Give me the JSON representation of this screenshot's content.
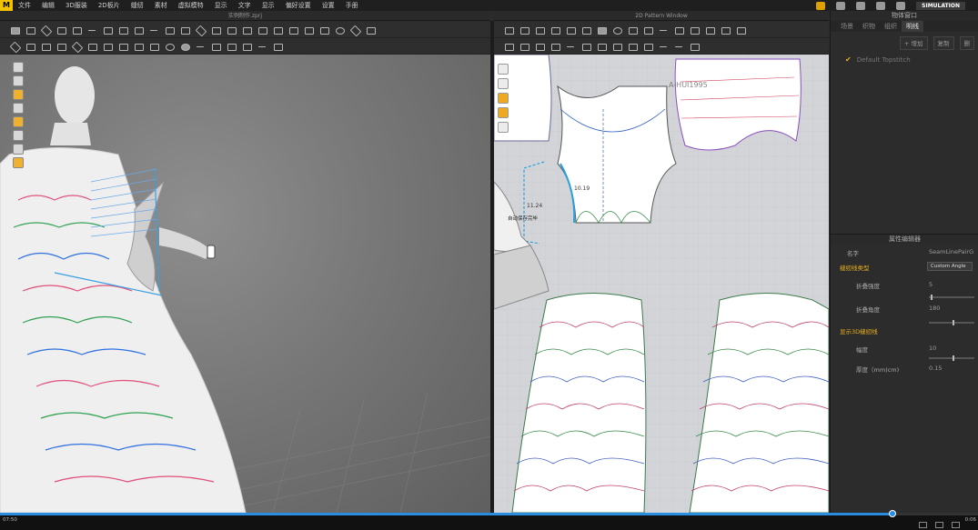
{
  "menu": {
    "logo": "M",
    "items": [
      "文件",
      "编辑",
      "3D服装",
      "2D板片",
      "缝纫",
      "素材",
      "虚拟模特",
      "显示",
      "文字",
      "显示",
      "偏好设置",
      "设置",
      "手册"
    ],
    "mode": "SIMULATION"
  },
  "windows": {
    "view3d_title": "实例制作.zprj",
    "view2d_title": "2D Pattern Window"
  },
  "pattern_view": {
    "watermark": "A-HUI1995",
    "measure_1": "10.19",
    "measure_2": "11.24",
    "tooltip": "自动保存完毕"
  },
  "right_panel": {
    "title": "物体窗口",
    "tabs": [
      "场景",
      "织物",
      "组织",
      "明线"
    ],
    "active_tab": "明线",
    "add_button": "+ 增加",
    "copy_button": "复制",
    "button_3": "删",
    "fabric_item": "Default Topstitch",
    "property_title": "属性编辑器",
    "name_label": "名字",
    "name_value": "SeamLinePairG",
    "section_seam_type": "缝纫线类型",
    "seam_type_value": "Custom Angle",
    "fold_strength_label": "折叠强度",
    "fold_strength_value": "5",
    "fold_angle_label": "折叠角度",
    "fold_angle_value": "180",
    "section_show_3d": "显示3D缝纫线",
    "width_label": "幅度",
    "width_value": "10",
    "thickness_label": "厚度（mm)cm)",
    "thickness_value": "0.15"
  },
  "playback": {
    "current_time": "07:50",
    "end_time": "0:06",
    "progress": 0.913
  },
  "colors": {
    "accent": "#f2c200",
    "progress": "#2a8de0",
    "pattern_bg": "#d2d4d7",
    "section": "#e8b020"
  }
}
